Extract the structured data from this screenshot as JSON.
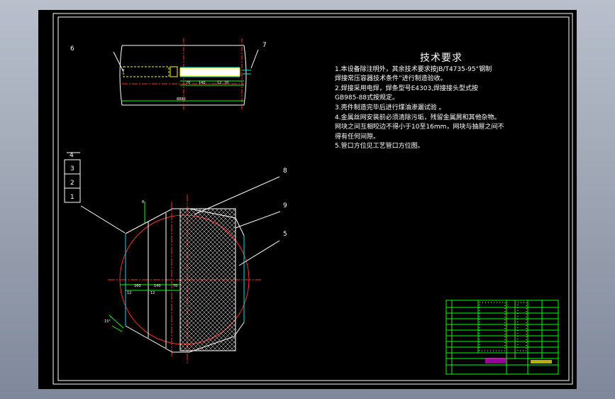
{
  "requirements": {
    "title": "技术要求",
    "lines": [
      "1.本设备除注明外，其余技术要求按JB/T4735-95“钢制",
      "焊接常压容器技术条件”进行制造验收。",
      "2.焊接采用电焊，焊条型号E4303,焊接接头型式按",
      "GB985-88式按规定。",
      "3.壳件制造完毕后进行煤油渗漏试验 。",
      "4.金属丝网安装前必须清除污垢，残留金属屑和其他杂物。",
      "网块之间互相咬边不得小于10至16mm，网块与抽屉之间不",
      "得有任何间隙。",
      "5.管口方位见工艺管口方位图。"
    ]
  },
  "callouts": {
    "c6": "6",
    "c7": "7",
    "c8": "8",
    "c9": "9",
    "c5": "5",
    "c1": "1",
    "c2": "2",
    "c3": "3",
    "c4": "4"
  },
  "dimensions": {
    "d1": "70",
    "d2": "140",
    "d3": "12",
    "d4": "70",
    "total": "8880",
    "s1": "160",
    "s2": "140",
    "s3": "70",
    "s4": "12",
    "s5": "12",
    "angle": "15°",
    "r": "R"
  },
  "colors": {
    "background": "#000000",
    "lines": "#ffffff",
    "cyan": "#00e5e5",
    "yellow": "#ffff00",
    "red": "#ff2a2a",
    "green": "#00ff00",
    "magenta": "#ff00ff"
  }
}
